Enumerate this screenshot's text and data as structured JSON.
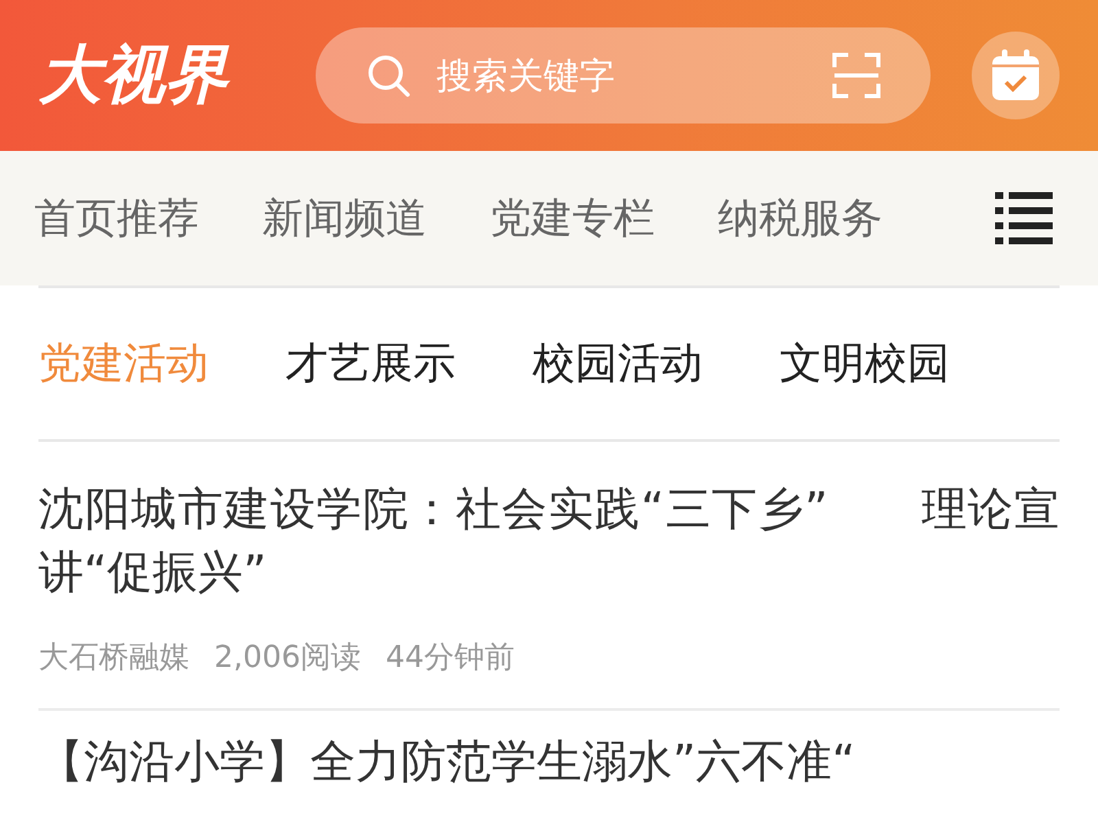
{
  "header": {
    "logo": "大视界",
    "search": {
      "placeholder": "搜索关键字"
    }
  },
  "channels": [
    {
      "label": "首页推荐",
      "selected": false
    },
    {
      "label": "新闻频道",
      "selected": false
    },
    {
      "label": "党建专栏",
      "selected": false
    },
    {
      "label": "纳税服务",
      "selected": false
    }
  ],
  "subtabs": [
    {
      "label": "党建活动",
      "selected": true
    },
    {
      "label": "才艺展示",
      "selected": false
    },
    {
      "label": "校园活动",
      "selected": false
    },
    {
      "label": "文明校园",
      "selected": false
    }
  ],
  "articles": [
    {
      "title": "沈阳城市建设学院：社会实践“三下乡”　　理论宣讲“促振兴”",
      "source": "大石桥融媒",
      "reads": "2,006阅读",
      "time": "44分钟前"
    },
    {
      "title": "【沟沿小学】全力防范学生溺水”六不准“"
    }
  ]
}
